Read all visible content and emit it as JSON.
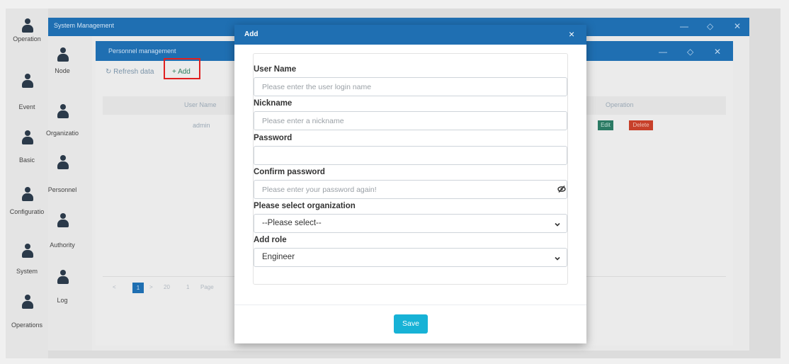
{
  "outer_nav": {
    "items": [
      {
        "label": "Operation"
      },
      {
        "label": "Event"
      },
      {
        "label": "Basic"
      },
      {
        "label": "Configuratio"
      },
      {
        "label": "System"
      },
      {
        "label": "Operations"
      }
    ]
  },
  "win1": {
    "title": "System Management",
    "minimize": "—",
    "restore": "◇",
    "close": "✕",
    "nav": [
      {
        "label": "Node"
      },
      {
        "label": "Organizatio"
      },
      {
        "label": "Personnel"
      },
      {
        "label": "Authority"
      },
      {
        "label": "Log"
      }
    ]
  },
  "win2": {
    "title": "Personnel management",
    "minimize": "—",
    "restore": "◇",
    "close": "✕",
    "toolbar": {
      "refresh_icon": "↻",
      "refresh_label": "Refresh data",
      "add_icon": "+",
      "add_label": "Add"
    },
    "grid": {
      "headers": {
        "user_name": "User Name",
        "operation": "Operation"
      },
      "rows": [
        {
          "user_name": "admin",
          "edit": "Edit",
          "delete": "Delete"
        }
      ]
    },
    "pager": {
      "prev": "<",
      "current": "1",
      "next": ">",
      "size": "20",
      "page_input": "1",
      "page_label": "Page"
    }
  },
  "modal": {
    "title": "Add",
    "close": "×",
    "fields": {
      "username": {
        "label": "User Name",
        "placeholder": "Please enter the user login name"
      },
      "nickname": {
        "label": "Nickname",
        "placeholder": "Please enter a nickname"
      },
      "password": {
        "label": "Password",
        "placeholder": ""
      },
      "confirm": {
        "label": "Confirm password",
        "placeholder": "Please enter your password again!"
      },
      "organization": {
        "label": "Please select organization",
        "value": "--Please select--"
      },
      "role": {
        "label": "Add role",
        "value": "Engineer"
      }
    },
    "save_label": "Save"
  },
  "icons": {
    "person": "person-icon",
    "eye": "eye-slash-icon",
    "chevron": "chevron-down-icon"
  },
  "colors": {
    "titlebar": "#1f6fb2",
    "save": "#17b2d6",
    "edit": "#2b7a64",
    "delete": "#c7402a",
    "highlight": "#e02020"
  }
}
